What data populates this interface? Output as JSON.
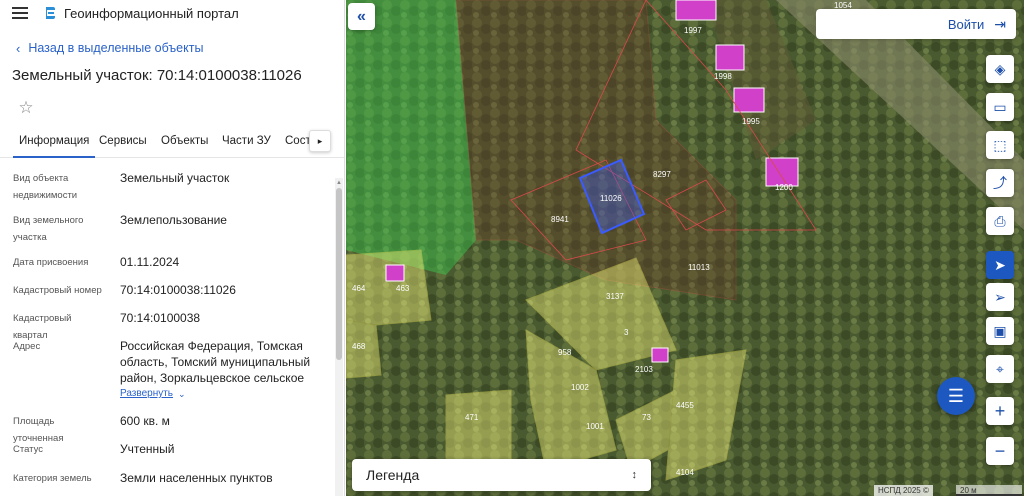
{
  "header": {
    "app_title": "Геоинформационный портал"
  },
  "nav": {
    "back_label": "Назад в выделенные объекты"
  },
  "object": {
    "title": "Земельный участок: 70:14:0100038:11026"
  },
  "tabs": [
    {
      "label": "Информация",
      "active": true
    },
    {
      "label": "Сервисы"
    },
    {
      "label": "Объекты"
    },
    {
      "label": "Части ЗУ"
    },
    {
      "label": "Соста"
    }
  ],
  "tab_more_label": "▸",
  "properties": [
    {
      "label": "Вид объекта недвижимости",
      "value": "Земельный участок"
    },
    {
      "label": "Вид земельного участка",
      "value": "Землепользование"
    },
    {
      "label": "Дата присвоения",
      "value": "01.11.2024"
    },
    {
      "label": "Кадастровый номер",
      "value": "70:14:0100038:11026"
    },
    {
      "label": "Кадастровый квартал",
      "value": "70:14:0100038"
    },
    {
      "label": "Адрес",
      "value": "Российская Федерация, Томская область, Томский муниципальный район, Зоркальцевское сельское"
    },
    {
      "label": "Площадь уточненная",
      "value": "600 кв. м"
    },
    {
      "label": "Статус",
      "value": "Учтенный"
    },
    {
      "label": "Категория земель",
      "value": "Земли населенных пунктов"
    }
  ],
  "expand_label": "Развернуть",
  "map": {
    "login_label": "Войти",
    "legend_label": "Легенда",
    "attribution": "НСПД 2025 ©",
    "scale_label": "20 м",
    "parcels": [
      "1054",
      "1997",
      "1998",
      "1995",
      "1200",
      "8297",
      "11026",
      "8941",
      "11013",
      "464",
      "463",
      "3137",
      "3",
      "468",
      "958",
      "2103",
      "1002",
      "471",
      "73",
      "1001",
      "4455",
      "4104"
    ],
    "selected_parcel": "11026"
  },
  "colors": {
    "accent": "#2a62c9",
    "selected_parcel": "#3a5bff",
    "zone_yellow": "#f0f07a",
    "zone_green": "#3ecf52",
    "chat": "#1d57c0"
  }
}
